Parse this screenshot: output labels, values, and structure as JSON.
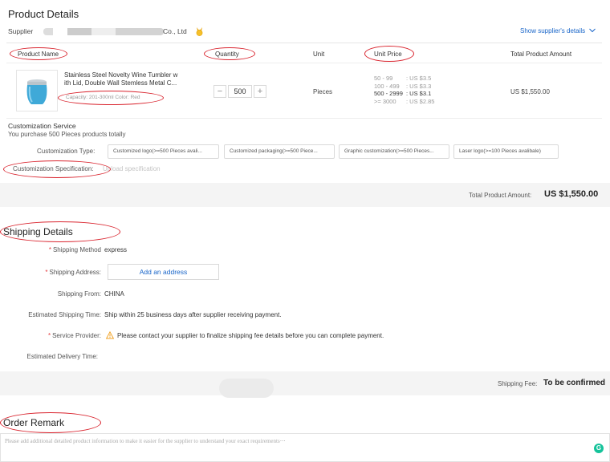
{
  "product_section": {
    "title": "Product Details",
    "supplier_label": "Supplier",
    "supplier_name_suffix": "Co., Ltd",
    "show_supplier_link": "Show supplier's details",
    "columns": [
      "Product Name",
      "Quantity",
      "Unit",
      "Unit Price",
      "Total Product Amount"
    ],
    "product": {
      "name_line1": "Stainless Steel Novelty Wine Tumbler w",
      "name_line2": "ith Lid, Double Wall Stemless Metal C...",
      "attributes": "Capacity: 201-300ml Color: Red",
      "quantity": "500",
      "unit": "Pieces",
      "price_tiers": [
        {
          "range": "50 - 99",
          "price": ": US $3.5"
        },
        {
          "range": "100 - 499",
          "price": ": US $3.3"
        },
        {
          "range": "500 - 2999",
          "price": ": US $3.1"
        },
        {
          "range": ">= 3000",
          "price": ": US $2.85"
        }
      ],
      "total": "US $1,550.00"
    },
    "customization": {
      "title": "Customization Service",
      "subtitle": "You purchase 500 Pieces products totally",
      "type_label": "Customization Type:",
      "types": [
        "Customized logo(>=500 Pieces avali...",
        "Customized packaging(>=500 Piece...",
        "Graphic customization(>=500 Pieces...",
        "Laser logo(>=100 Pieces avalibale)"
      ],
      "spec_label": "Customization Specification:",
      "spec_action": "Upload specification"
    },
    "total_label": "Total Product Amount:",
    "total_value": "US $1,550.00"
  },
  "shipping_section": {
    "title": "Shipping Details",
    "method_label": "Shipping Method",
    "method_value": "express",
    "address_label": "Shipping Address:",
    "address_button": "Add an address",
    "from_label": "Shipping From:",
    "from_value": "CHINA",
    "time_label": "Estimated Shipping Time:",
    "time_value": "Ship within 25 business days after supplier receiving payment.",
    "provider_label": "Service Provider:",
    "provider_value": "Please contact your supplier to finalize shipping fee details before you can complete payment.",
    "delivery_label": "Estimated Delivery Time:",
    "fee_label": "Shipping Fee:",
    "fee_value": "To be confirmed"
  },
  "remark_section": {
    "title": "Order Remark",
    "placeholder": "Please add additional detailed product information to make it easier for the supplier to understand your exact requirements⋯"
  },
  "colors": {
    "accent_red": "#d9232d",
    "link_blue": "#1a66c9",
    "warning_orange": "#f0a020",
    "grammarly_green": "#15c39a"
  },
  "icons": {
    "supplier_badge": "gold-medal-icon",
    "chevron": "chevron-down-icon",
    "warning": "warning-triangle-icon",
    "grammarly": "grammarly-icon"
  }
}
